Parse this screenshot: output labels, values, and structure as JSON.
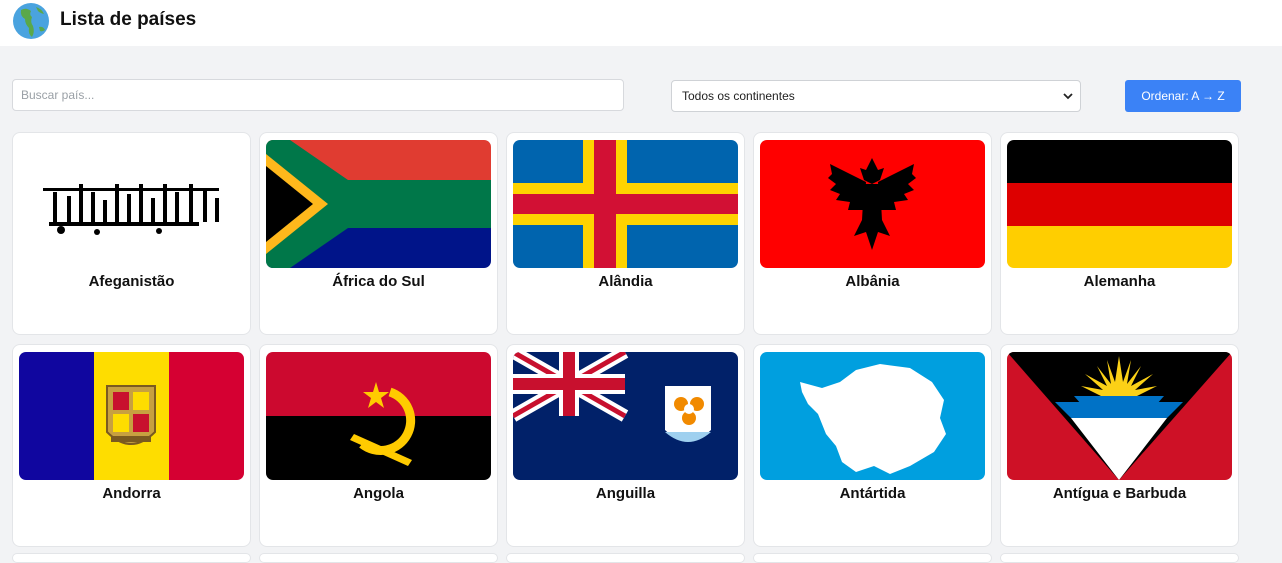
{
  "header": {
    "title": "Lista de países",
    "logo_icon": "globe-americas-icon"
  },
  "controls": {
    "search_placeholder": "Buscar país...",
    "continent_selected": "Todos os continentes",
    "sort_label": "Ordenar: A → Z"
  },
  "colors": {
    "accent": "#3b82f6",
    "page_bg": "#f2f3f5"
  },
  "countries": [
    {
      "name": "Afeganistão"
    },
    {
      "name": "África do Sul"
    },
    {
      "name": "Alândia"
    },
    {
      "name": "Albânia"
    },
    {
      "name": "Alemanha"
    },
    {
      "name": "Andorra"
    },
    {
      "name": "Angola"
    },
    {
      "name": "Anguilla"
    },
    {
      "name": "Antártida"
    },
    {
      "name": "Antígua e Barbuda"
    }
  ]
}
